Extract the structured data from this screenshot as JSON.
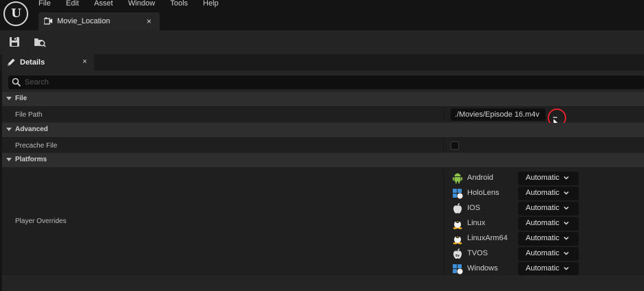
{
  "app": {
    "menu": [
      "File",
      "Edit",
      "Asset",
      "Window",
      "Tools",
      "Help"
    ],
    "document_tab": {
      "label": "Movie_Location",
      "close": "×"
    }
  },
  "details": {
    "tab_label": "Details",
    "tab_close": "×",
    "search_placeholder": "Search",
    "categories": {
      "file": "File",
      "advanced": "Advanced",
      "platforms": "Platforms"
    },
    "properties": {
      "file_path_label": "File Path",
      "file_path_value": "./Movies/Episode 16.m4v",
      "browse_label": "...",
      "precache_label": "Precache File",
      "player_overrides_label": "Player Overrides"
    },
    "platforms": [
      {
        "name": "Android",
        "value": "Automatic",
        "icon": "android-icon"
      },
      {
        "name": "HoloLens",
        "value": "Automatic",
        "icon": "windows-unreal-icon"
      },
      {
        "name": "IOS",
        "value": "Automatic",
        "icon": "apple-icon"
      },
      {
        "name": "Linux",
        "value": "Automatic",
        "icon": "linux-icon"
      },
      {
        "name": "LinuxArm64",
        "value": "Automatic",
        "icon": "linux-icon"
      },
      {
        "name": "TVOS",
        "value": "Automatic",
        "icon": "apple-tv-icon"
      },
      {
        "name": "Windows",
        "value": "Automatic",
        "icon": "windows-unreal-icon"
      }
    ]
  },
  "colors": {
    "highlight_ring": "#e0202a",
    "panel_bg": "#242424",
    "category_bg": "#2e2e2e",
    "android_green": "#8bc34a",
    "windows_blue": "#3d8fd6"
  }
}
